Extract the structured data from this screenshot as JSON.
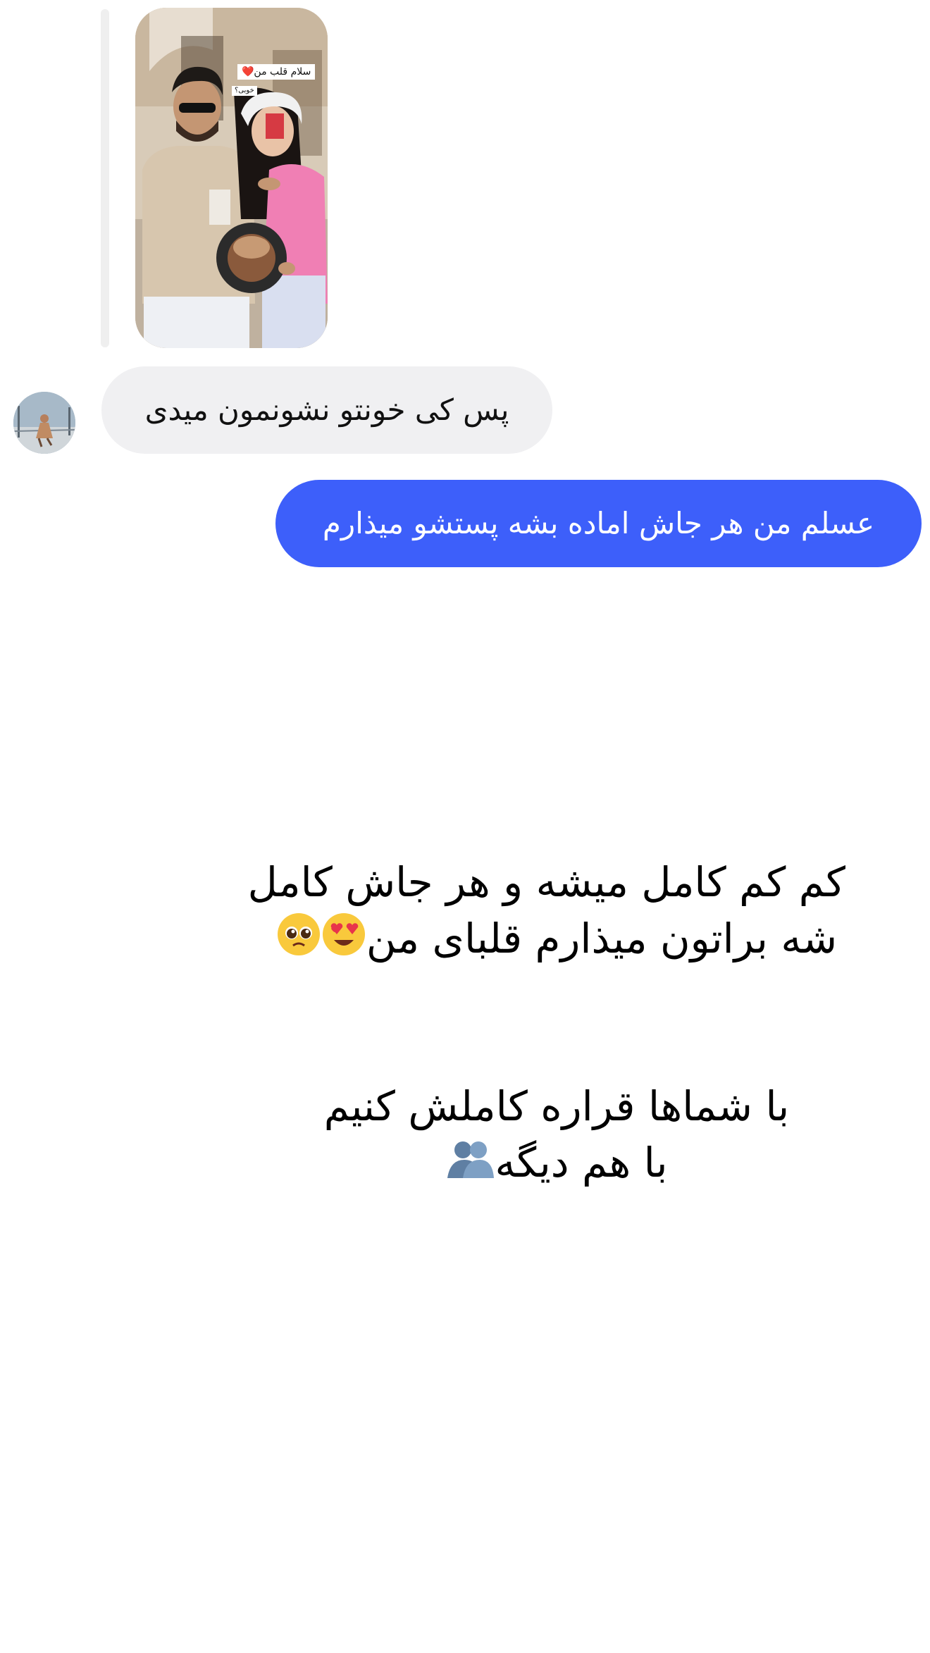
{
  "story_reply": {
    "sticker_primary": "سلام قلب من❤️",
    "sticker_secondary": "خوبی؟"
  },
  "messages": [
    {
      "direction": "incoming",
      "text": "پس کی خونتو نشونمون میدی"
    },
    {
      "direction": "outgoing",
      "text": "عسلم من هر جاش اماده بشه پستشو میذارم"
    }
  ],
  "caption": {
    "paragraph1_line1": "کم کم کامل میشه و هر جاش کامل",
    "paragraph1_line2": "شه براتون میذارم قلبای من",
    "paragraph2_line1": "با شماها قراره کاملش کنیم",
    "paragraph2_line2": "با هم دیگه"
  },
  "icons": {
    "emoji_1": "heart-eyes-emoji",
    "emoji_2": "pleading-face-emoji",
    "emoji_3": "people-hugging-emoji"
  },
  "colors": {
    "outgoing_bubble": "#3d5ffa",
    "incoming_bubble": "#f0f0f2",
    "background": "#ffffff"
  }
}
